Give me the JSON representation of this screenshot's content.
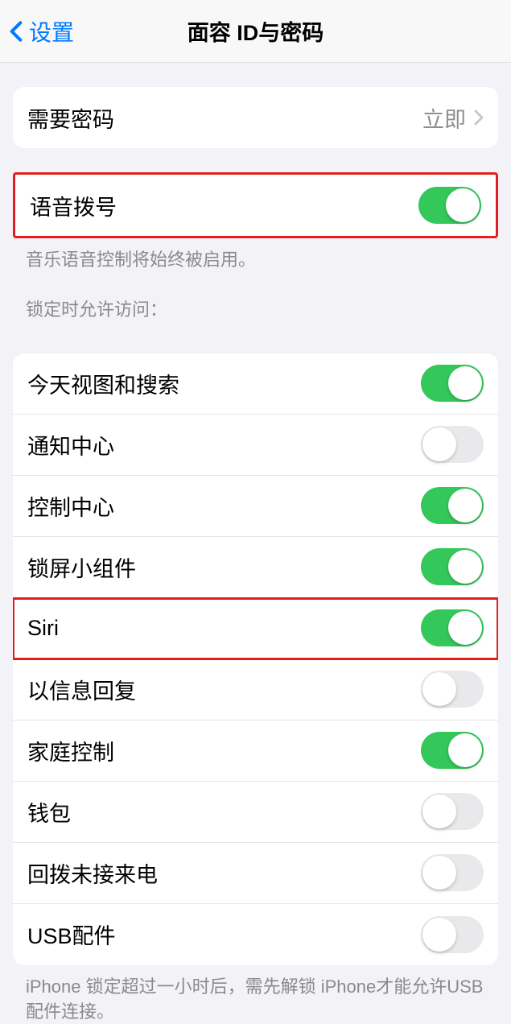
{
  "nav": {
    "back_label": "设置",
    "title": "面容 ID与密码"
  },
  "passcode_group": {
    "require_passcode_label": "需要密码",
    "require_passcode_value": "立即"
  },
  "voice_dial": {
    "label": "语音拨号",
    "on": true,
    "footer": "音乐语音控制将始终被启用。"
  },
  "locked_access": {
    "header": "锁定时允许访问：",
    "items": [
      {
        "label": "今天视图和搜索",
        "on": true
      },
      {
        "label": "通知中心",
        "on": false
      },
      {
        "label": "控制中心",
        "on": true
      },
      {
        "label": "锁屏小组件",
        "on": true
      },
      {
        "label": "Siri",
        "on": true
      },
      {
        "label": "以信息回复",
        "on": false
      },
      {
        "label": "家庭控制",
        "on": true
      },
      {
        "label": "钱包",
        "on": false
      },
      {
        "label": "回拨未接来电",
        "on": false
      },
      {
        "label": "USB配件",
        "on": false
      }
    ],
    "footer": "iPhone 锁定超过一小时后，需先解锁 iPhone才能允许USB 配件连接。"
  }
}
